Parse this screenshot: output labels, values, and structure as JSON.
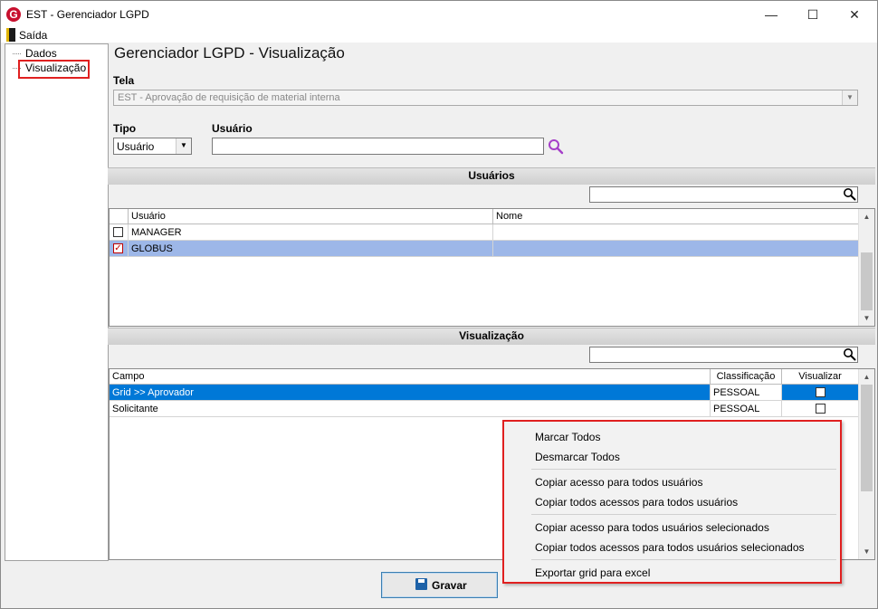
{
  "window": {
    "app_icon_letter": "G",
    "title": "EST - Gerenciador LGPD",
    "controls": {
      "minimize": "—",
      "maximize": "☐",
      "close": "✕"
    }
  },
  "menu": {
    "exit_label": "Saída"
  },
  "tree": {
    "items": [
      {
        "label": "Dados"
      },
      {
        "label": "Visualização",
        "selected": true
      }
    ]
  },
  "page": {
    "title": "Gerenciador LGPD - Visualização"
  },
  "form": {
    "tela_label": "Tela",
    "tela_value": "EST - Aprovação de requisição de material interna",
    "tipo_label": "Tipo",
    "tipo_value": "Usuário",
    "usuario_label": "Usuário",
    "usuario_value": ""
  },
  "users_section": {
    "title": "Usuários",
    "search_value": "",
    "columns": [
      "Usuário",
      "Nome"
    ],
    "rows": [
      {
        "checked": false,
        "usuario": "MANAGER",
        "nome": ""
      },
      {
        "checked": true,
        "usuario": "GLOBUS",
        "nome": ""
      }
    ]
  },
  "view_section": {
    "title": "Visualização",
    "search_value": "",
    "columns": [
      "Campo",
      "Classificação",
      "Visualizar"
    ],
    "rows": [
      {
        "campo": "Grid >> Aprovador",
        "classificacao": "PESSOAL",
        "visualizar": false,
        "selected": true
      },
      {
        "campo": "Solicitante",
        "classificacao": "PESSOAL",
        "visualizar": false,
        "selected": false
      }
    ]
  },
  "context_menu": {
    "items": [
      "Marcar Todos",
      "Desmarcar Todos",
      "Copiar acesso para todos usuários",
      "Copiar todos acessos para todos usuários",
      "Copiar acesso para todos usuários selecionados",
      "Copiar todos acessos para todos usuários selecionados",
      "Exportar grid para excel"
    ]
  },
  "footer": {
    "save_label": "Gravar"
  },
  "colors": {
    "selection_blue": "#0078d7",
    "row_highlight": "#9db7e8",
    "annotation_red": "#e02020",
    "app_red": "#c8102e"
  }
}
